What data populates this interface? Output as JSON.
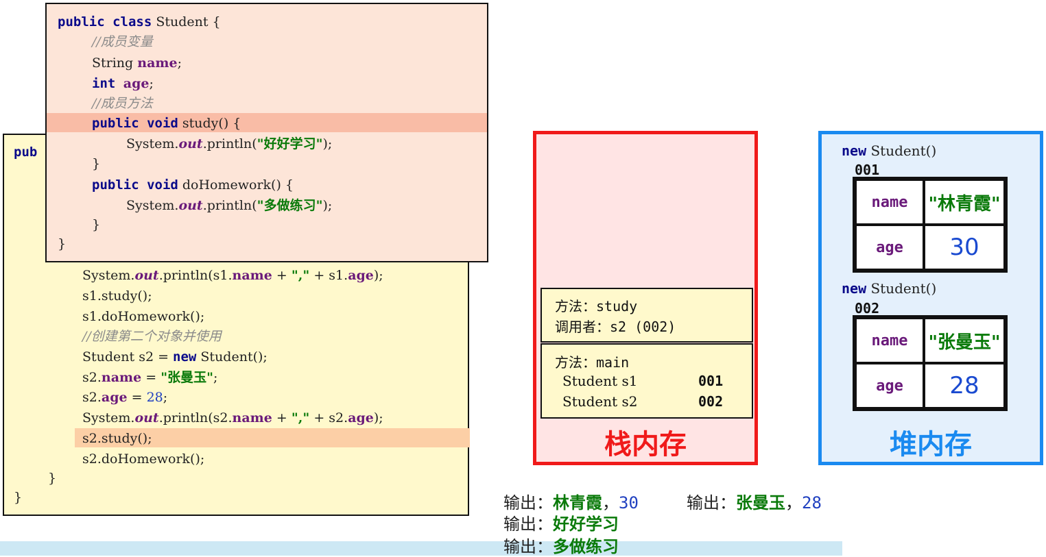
{
  "front_code": {
    "l1_kw": "public class",
    "l1_rest": " Student {",
    "l2_comment": "//成员变量",
    "l3_type": "String ",
    "l3_field": "name",
    "l3_end": ";",
    "l4_kw": "int ",
    "l4_field": "age",
    "l4_end": ";",
    "l5_comment": "//成员方法",
    "l6_kw": "public void",
    "l6_rest": " study() {",
    "l7_pre": "System.",
    "l7_out": "out",
    "l7_mid": ".println(",
    "l7_str": "\"好好学习\"",
    "l7_end": ");",
    "l8": "}",
    "l9_kw": "public void",
    "l9_rest": " doHomework() {",
    "l10_pre": "System.",
    "l10_out": "out",
    "l10_mid": ".println(",
    "l10_str": "\"多做练习\"",
    "l10_end": ");",
    "l11": "}",
    "l12": "}"
  },
  "back_code": {
    "peek": "pub",
    "b1_pre": "System.",
    "b1_out": "out",
    "b1_mid": ".println(s1.",
    "b1_f1": "name",
    "b1_plus1": " + ",
    "b1_str": "\",\"",
    "b1_plus2": " + s1.",
    "b1_f2": "age",
    "b1_end": ");",
    "b2": "s1.study();",
    "b3": "s1.doHomework();",
    "b4_comment": "//创建第二个对象并使用",
    "b5_pre": "Student s2 = ",
    "b5_kw": "new",
    "b5_end": " Student();",
    "b6_pre": "s2.",
    "b6_field": "name",
    "b6_eq": " = ",
    "b6_str": "\"张曼玉\"",
    "b6_end": ";",
    "b7_pre": "s2.",
    "b7_field": "age",
    "b7_eq": " = ",
    "b7_num": "28",
    "b7_end": ";",
    "b8_pre": "System.",
    "b8_out": "out",
    "b8_mid": ".println(s2.",
    "b8_f1": "name",
    "b8_plus1": " + ",
    "b8_str": "\",\"",
    "b8_plus2": " + s2.",
    "b8_f2": "age",
    "b8_end": ");",
    "b9": "s2.study();",
    "b10": "s2.doHomework();",
    "b11": "}",
    "b12": "}"
  },
  "stack": {
    "title": "栈内存",
    "frame_study": {
      "line1": "方法：study",
      "line2": "调用者：s2 (002)"
    },
    "frame_main": {
      "line1": "方法：main",
      "var1": "Student s1",
      "val1": "001",
      "var2": "Student s2",
      "val2": "002"
    }
  },
  "heap": {
    "title": "堆内存",
    "objects": [
      {
        "new_kw": "new",
        "new_rest": " Student()",
        "addr": "001",
        "f1": "name",
        "v1": "\"林青霞\"",
        "f2": "age",
        "v2": "30"
      },
      {
        "new_kw": "new",
        "new_rest": " Student()",
        "addr": "002",
        "f1": "name",
        "v1": "\"张曼玉\"",
        "f2": "age",
        "v2": "28"
      }
    ]
  },
  "output": {
    "l1_label": "输出：",
    "l1_name": "林青霞",
    "l1_sep": "，",
    "l1_num": "30",
    "l2_label": "输出：",
    "l2_name": "张曼玉",
    "l2_sep": "，",
    "l2_num": "28",
    "l3_label": "输出：",
    "l3_text": "好好学习",
    "l4_label": "输出：",
    "l4_text": "多做练习"
  },
  "colors": {
    "stack_border": "#f01a1a",
    "heap_border": "#1a8af0",
    "string": "#0a7a0a",
    "number": "#2040c0"
  }
}
